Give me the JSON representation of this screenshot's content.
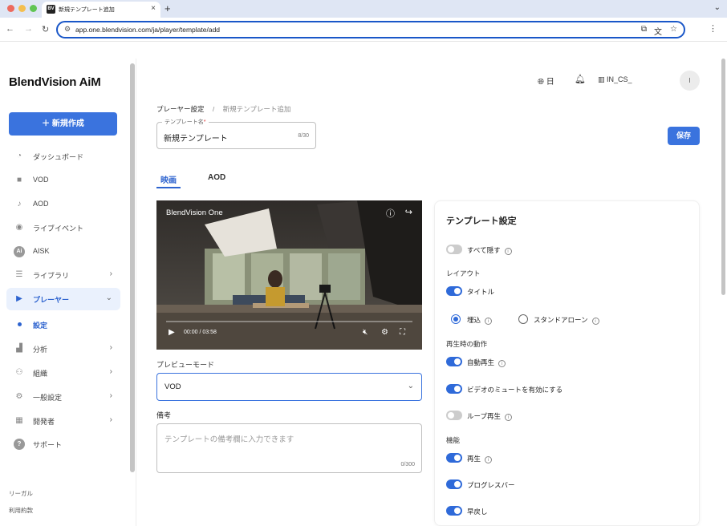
{
  "browser": {
    "tab_title": "新規テンプレート追加",
    "favicon_text": "BV",
    "url": "app.one.blendvision.com/ja/player/template/add"
  },
  "sidebar": {
    "logo": "BlendVision AiM",
    "new_button": "＋  新規作成",
    "items": [
      {
        "label": "ダッシュボード",
        "icon": "dashboard-icon"
      },
      {
        "label": "VOD",
        "icon": "vod-icon"
      },
      {
        "label": "AOD",
        "icon": "music-note-icon"
      },
      {
        "label": "ライブイベント",
        "icon": "broadcast-icon"
      },
      {
        "label": "AISK",
        "icon": "ai-icon"
      },
      {
        "label": "ライブラリ",
        "icon": "library-icon"
      },
      {
        "label": "プレーヤー",
        "icon": "player-icon"
      },
      {
        "label": "分析",
        "icon": "chart-icon"
      },
      {
        "label": "組織",
        "icon": "people-icon"
      },
      {
        "label": "一般設定",
        "icon": "gear-icon"
      },
      {
        "label": "開発者",
        "icon": "grid-icon"
      },
      {
        "label": "サポート",
        "icon": "help-icon"
      }
    ],
    "sub_item": "設定",
    "legal": "リーガル",
    "terms": "利用約款"
  },
  "header": {
    "language": "日",
    "org": "IN_CS_",
    "avatar": "I"
  },
  "breadcrumb": {
    "parent": "プレーヤー設定",
    "separator": "/",
    "current": "新規テンプレート追加"
  },
  "template_name": {
    "label": "テンプレート名",
    "required_mark": "*",
    "value": "新規テンプレート",
    "count": "8/30"
  },
  "save_button": "保存",
  "tabs": {
    "video": "映画",
    "aod": "AOD"
  },
  "video": {
    "title": "BlendVision One",
    "time": "00:00 / 03:58",
    "progress": 0
  },
  "preview_mode": {
    "label": "プレビューモード",
    "value": "VOD"
  },
  "notes": {
    "label": "備考",
    "placeholder": "テンプレートの備考欄に入力できます",
    "count": "0/300"
  },
  "settings": {
    "title": "テンプレート設定",
    "hide_all": {
      "label": "すべて隠す",
      "on": false
    },
    "layout_label": "レイアウト",
    "title_toggle": {
      "label": "タイトル",
      "on": true
    },
    "embed": {
      "label": "埋込",
      "selected": true
    },
    "standalone": {
      "label": "スタンドアローン",
      "selected": false
    },
    "playback_label": "再生時の動作",
    "autoplay": {
      "label": "自動再生",
      "on": true
    },
    "mute": {
      "label": "ビデオのミュートを有効にする",
      "on": true
    },
    "loop": {
      "label": "ループ再生",
      "on": false
    },
    "features_label": "機能",
    "play": {
      "label": "再生",
      "on": true
    },
    "progress_bar": {
      "label": "プログレスバー",
      "on": true
    },
    "rewind": {
      "label": "早戻し",
      "on": true
    }
  },
  "colors": {
    "accent": "#3a73de",
    "toggle_on": "#2f6ad9",
    "toggle_off": "#cccccc"
  }
}
